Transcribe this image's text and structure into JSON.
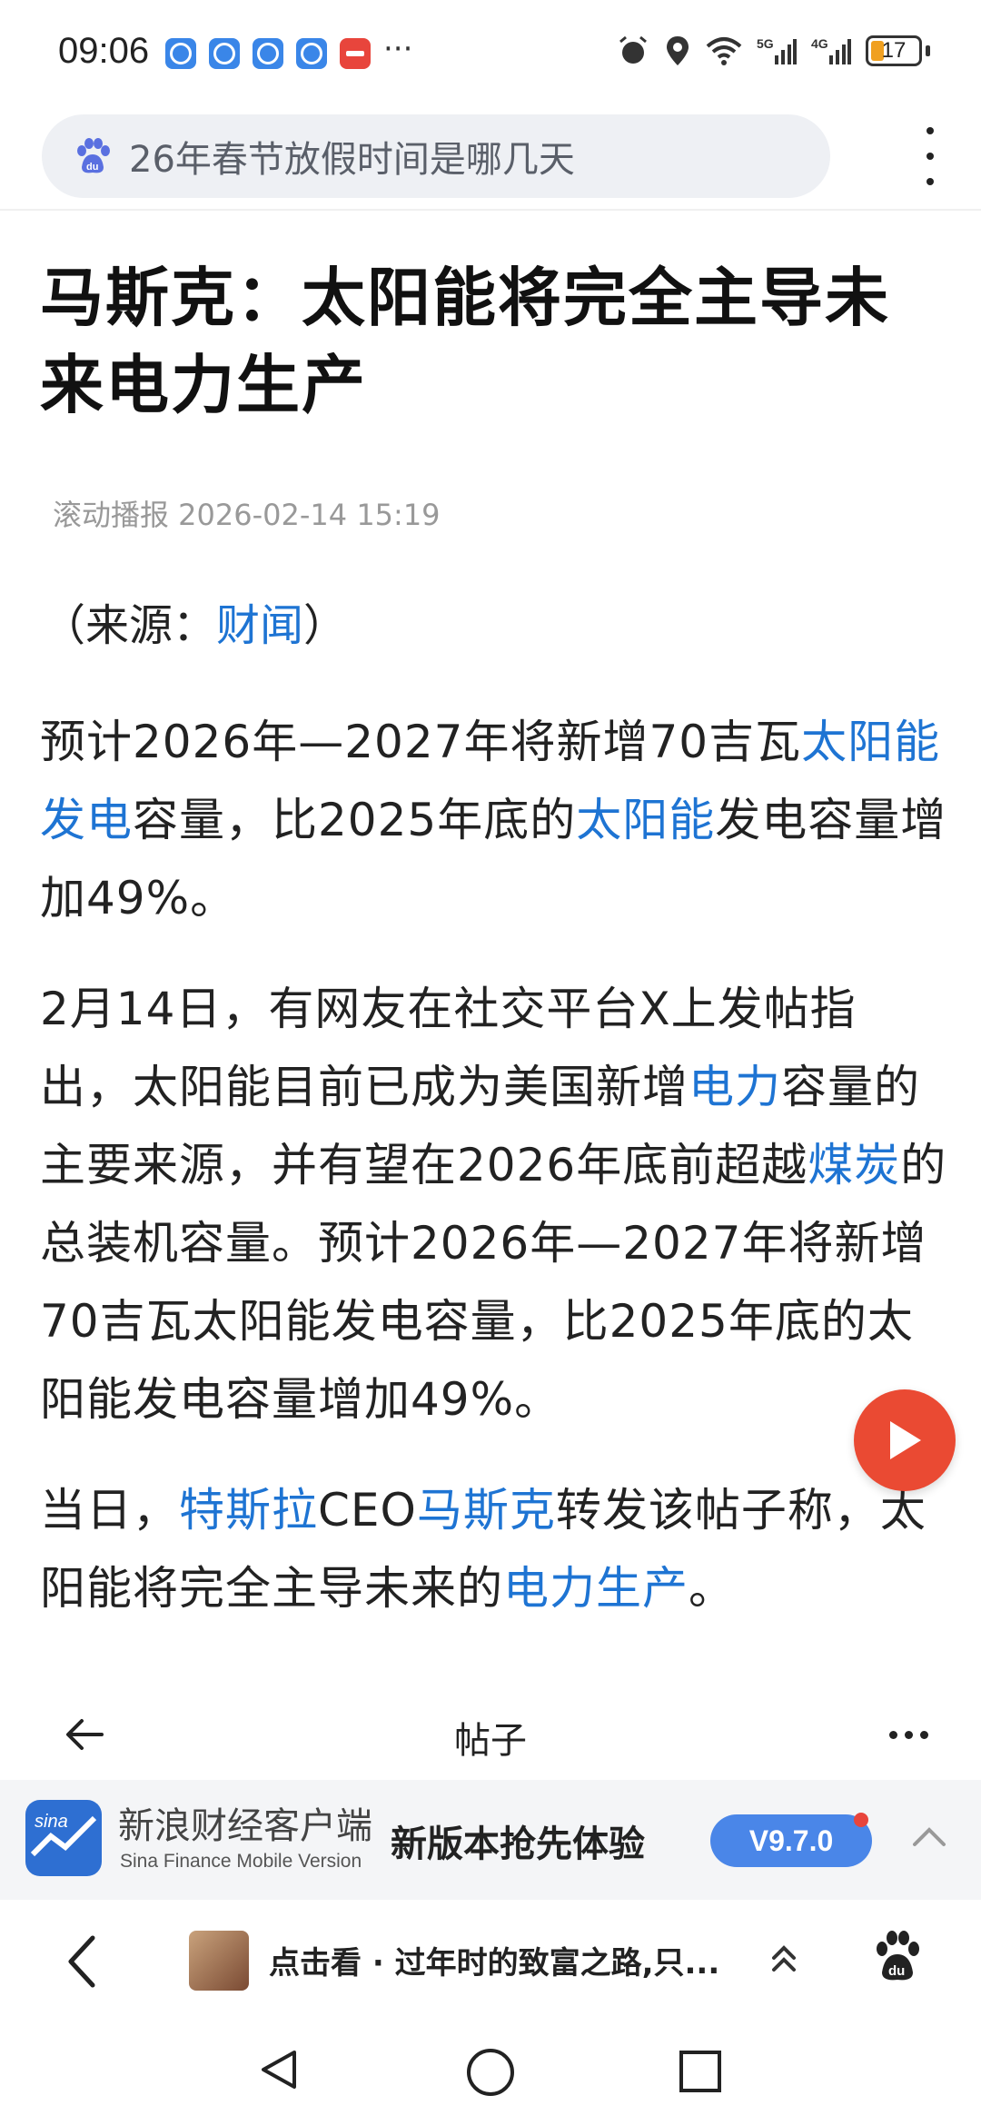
{
  "status_bar": {
    "time": "09:06",
    "battery": "17",
    "icons": [
      "clock-app-icon",
      "clock-app-icon",
      "clock-app-icon",
      "clock-app-icon",
      "huawei-app-icon",
      "more-notifications",
      "alarm-icon",
      "location-icon",
      "wifi-icon",
      "5g-signal-icon",
      "4g-signal-icon",
      "battery-icon"
    ],
    "more": "···"
  },
  "search": {
    "query": "26年春节放假时间是哪几天"
  },
  "article": {
    "title": "马斯克：太阳能将完全主导未来电力生产",
    "meta": "滚动播报 2026-02-14 15:19",
    "source_prefix": "（来源：",
    "source_link": "财闻",
    "source_suffix": "）",
    "p1": {
      "t1": "预计2026年—2027年将新增70吉瓦",
      "l1": "太阳能发电",
      "t2": "容量，比2025年底的",
      "l2": "太阳能",
      "t3": "发电容量增加49%。"
    },
    "p2": {
      "t1": "2月14日，有网友在社交平台X上发帖指出，太阳能目前已成为美国新增",
      "l1": "电力",
      "t2": "容量的主要来源，并有望在2026年底前超越",
      "l2": "煤炭",
      "t3": "的总装机容量。预计2026年—2027年将新增70吉瓦太阳能发电容量，比2025年底的太阳能发电容量增加49%。"
    },
    "p3": {
      "t1": "当日，",
      "l1": "特斯拉",
      "t2": "CEO",
      "l2": "马斯克",
      "t3": "转发该帖子称，太阳能将完全主导未来的",
      "l3": "电力生产",
      "t4": "。"
    }
  },
  "post_header": {
    "title": "帖子"
  },
  "app_banner": {
    "name": "新浪财经客户端",
    "subtitle": "Sina Finance Mobile Version",
    "promo": "新版本抢先体验",
    "version": "V9.7.0"
  },
  "bottom_bar": {
    "feed_text": "点击看 · 过年时的致富之路,只..."
  },
  "colors": {
    "link": "#1e74d3",
    "play_button": "#ea4a33",
    "version_badge": "#4a86e8"
  }
}
